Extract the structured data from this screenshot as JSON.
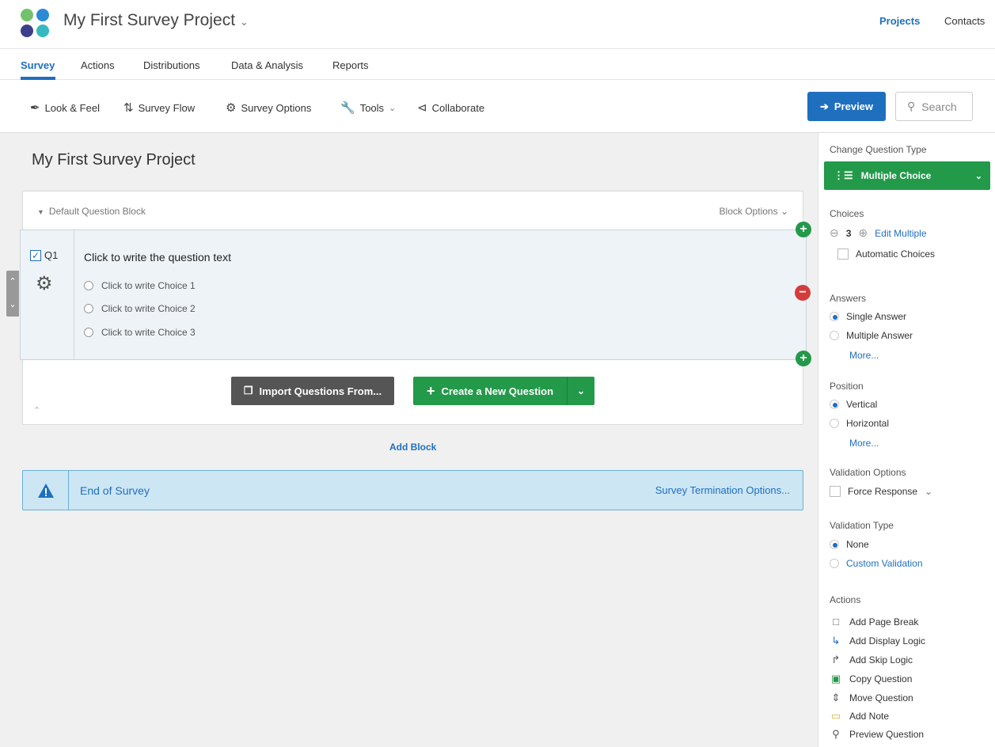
{
  "header": {
    "project_title": "My First Survey Project",
    "nav": {
      "projects": "Projects",
      "contacts": "Contacts"
    },
    "logo_colors": [
      "#73c26b",
      "#2a8ad6",
      "#3b3f8c",
      "#36b8c0"
    ]
  },
  "tabs": [
    "Survey",
    "Actions",
    "Distributions",
    "Data & Analysis",
    "Reports"
  ],
  "toolbar": {
    "look_feel": "Look & Feel",
    "survey_flow": "Survey Flow",
    "survey_options": "Survey Options",
    "tools": "Tools",
    "collaborate": "Collaborate",
    "preview": "Preview",
    "search_placeholder": "Search"
  },
  "main": {
    "title": "My First Survey Project",
    "block": {
      "name": "Default Question Block",
      "options": "Block Options"
    },
    "question": {
      "number": "Q1",
      "text": "Click to write the question text",
      "choices": [
        "Click to write Choice 1",
        "Click to write Choice 2",
        "Click to write Choice 3"
      ]
    },
    "import_button": "Import Questions From...",
    "create_button": "Create a New Question",
    "add_block": "Add Block",
    "end_of_survey": "End of Survey",
    "termination_options": "Survey Termination Options..."
  },
  "sidebar": {
    "change_type_title": "Change Question Type",
    "question_type": "Multiple Choice",
    "choices_title": "Choices",
    "choices_count": "3",
    "edit_multiple": "Edit Multiple",
    "automatic_choices": "Automatic Choices",
    "answers_title": "Answers",
    "answers": [
      {
        "label": "Single Answer",
        "selected": true
      },
      {
        "label": "Multiple Answer",
        "selected": false
      }
    ],
    "answers_more": "More...",
    "position_title": "Position",
    "position": [
      {
        "label": "Vertical",
        "selected": true
      },
      {
        "label": "Horizontal",
        "selected": false
      }
    ],
    "position_more": "More...",
    "validation_options_title": "Validation Options",
    "force_response": "Force Response",
    "validation_type_title": "Validation Type",
    "validation_types": [
      {
        "label": "None",
        "selected": true
      },
      {
        "label": "Custom Validation",
        "selected": false
      }
    ],
    "actions_title": "Actions",
    "actions": [
      {
        "label": "Add Page Break",
        "icon": "page-break-icon"
      },
      {
        "label": "Add Display Logic",
        "icon": "display-logic-icon"
      },
      {
        "label": "Add Skip Logic",
        "icon": "skip-logic-icon"
      },
      {
        "label": "Copy Question",
        "icon": "copy-icon"
      },
      {
        "label": "Move Question",
        "icon": "move-icon"
      },
      {
        "label": "Add Note",
        "icon": "note-icon"
      },
      {
        "label": "Preview Question",
        "icon": "search-icon"
      }
    ]
  }
}
